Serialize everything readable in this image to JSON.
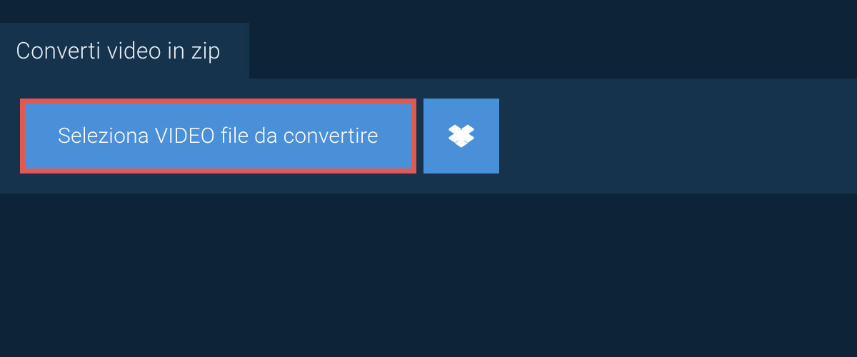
{
  "tab": {
    "label": "Converti video in zip"
  },
  "actions": {
    "select_file_label": "Seleziona VIDEO file da convertire"
  },
  "colors": {
    "background": "#0d2438",
    "panel": "#15334d",
    "button_primary": "#4a90d9",
    "button_highlight_border": "#e05a52",
    "text_light": "#ffffff"
  }
}
